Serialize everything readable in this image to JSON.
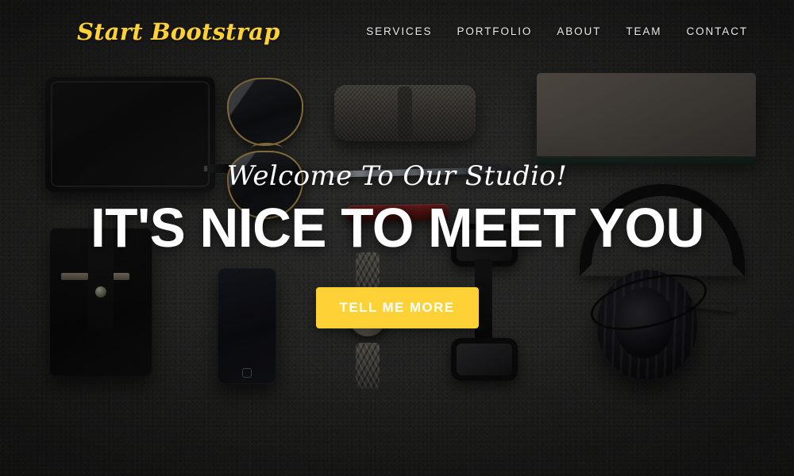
{
  "site": {
    "brand": "Start Bootstrap"
  },
  "nav": {
    "items": [
      {
        "label": "Services"
      },
      {
        "label": "Portfolio"
      },
      {
        "label": "About"
      },
      {
        "label": "Team"
      },
      {
        "label": "Contact"
      }
    ]
  },
  "hero": {
    "lead": "Welcome To Our Studio!",
    "heading": "It's Nice To Meet You",
    "cta_label": "Tell Me More"
  },
  "colors": {
    "accent": "#fed136",
    "text_light": "#ffffff",
    "nav_link": "#e8e8e8",
    "background": "#2e2e2d"
  },
  "background_photo": {
    "description": "Flat-lay of men's accessories on dark textured surface",
    "objects": [
      "zip-wallet",
      "aviator-sunglasses",
      "knit-bow-tie",
      "ballpoint-pen",
      "swiss-army-knife",
      "leather-clutch",
      "card-holder",
      "smartphone",
      "wristwatch",
      "eyeglasses",
      "headphones"
    ]
  }
}
